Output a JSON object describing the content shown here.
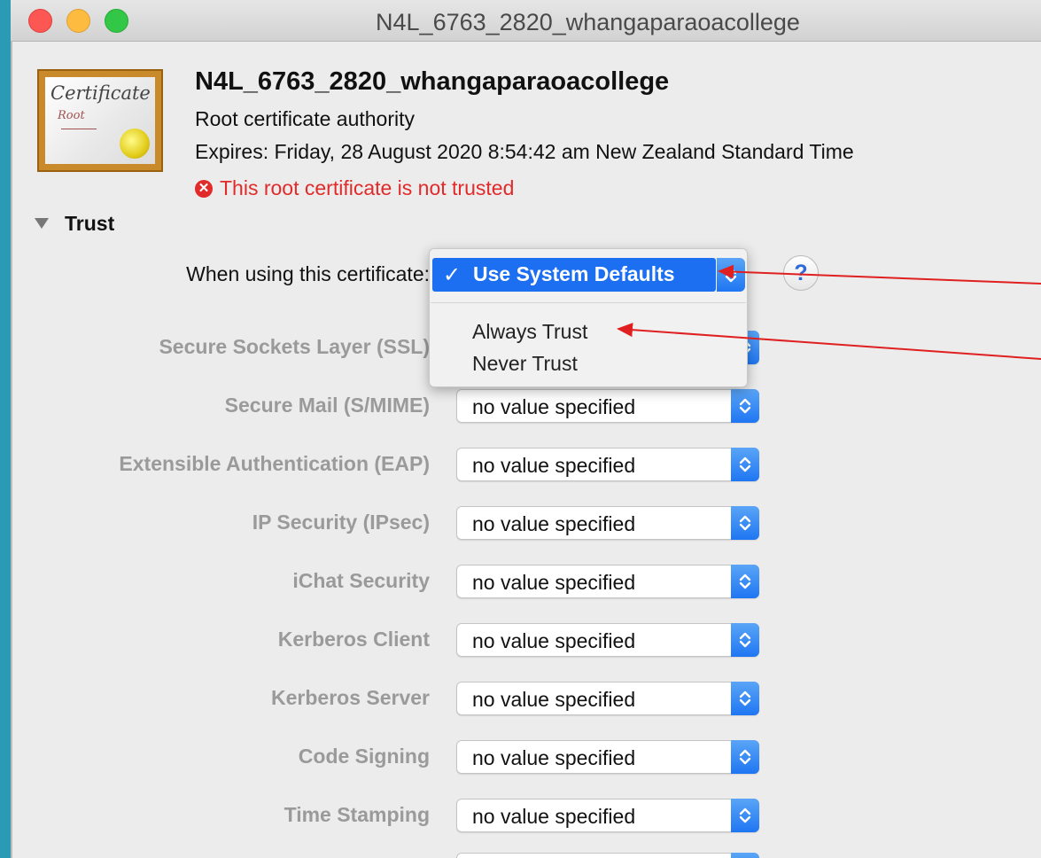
{
  "window": {
    "title": "N4L_6763_2820_whangaparaoacollege"
  },
  "certificate": {
    "icon_text": "Certificate",
    "icon_subtext": "Root",
    "name": "N4L_6763_2820_whangaparaoacollege",
    "kind": "Root certificate authority",
    "expires": "Expires: Friday, 28 August 2020 8:54:42 am New Zealand Standard Time",
    "warning": "This root certificate is not trusted"
  },
  "trust": {
    "header": "Trust",
    "when_using_label": "When using this certificate:",
    "help_label": "?",
    "popup": {
      "selected": "Use System Defaults",
      "options": [
        "Always Trust",
        "Never Trust"
      ]
    },
    "rows": [
      {
        "label": "Secure Sockets Layer (SSL)",
        "value": ""
      },
      {
        "label": "Secure Mail (S/MIME)",
        "value": "no value specified"
      },
      {
        "label": "Extensible Authentication (EAP)",
        "value": "no value specified"
      },
      {
        "label": "IP Security (IPsec)",
        "value": "no value specified"
      },
      {
        "label": "iChat Security",
        "value": "no value specified"
      },
      {
        "label": "Kerberos Client",
        "value": "no value specified"
      },
      {
        "label": "Kerberos Server",
        "value": "no value specified"
      },
      {
        "label": "Code Signing",
        "value": "no value specified"
      },
      {
        "label": "Time Stamping",
        "value": "no value specified"
      }
    ]
  },
  "colors": {
    "accent": "#1c6ff0",
    "warning": "#e12a2a",
    "annotation_arrow": "#e02020",
    "background": "#2b9bb5"
  },
  "icons": [
    "close-light",
    "minimize-light",
    "zoom-light",
    "certificate-icon",
    "error-icon",
    "disclosure-triangle-icon",
    "help-icon",
    "checkmark-icon",
    "stepper-icon"
  ]
}
